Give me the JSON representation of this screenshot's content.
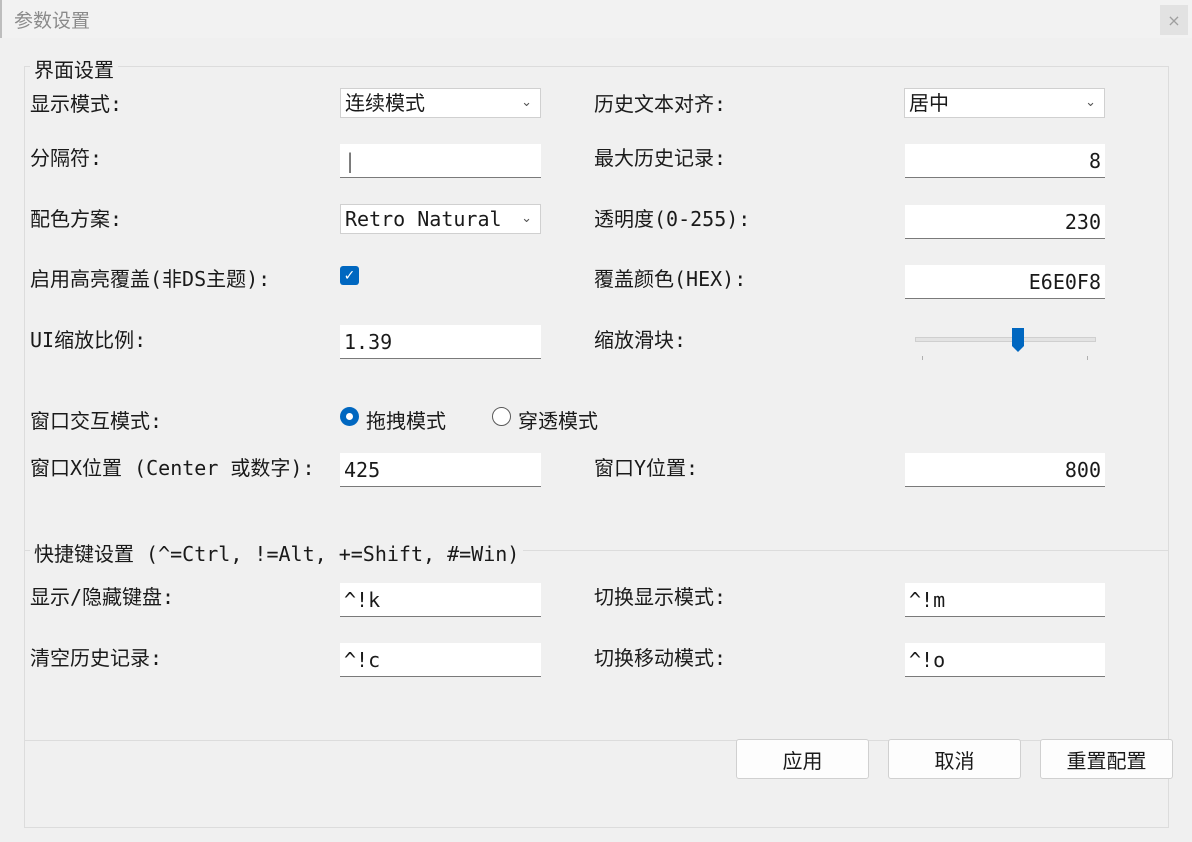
{
  "window": {
    "title": "参数设置",
    "close_glyph": "×"
  },
  "ui_group": {
    "label": "界面设置",
    "display_mode": {
      "label": "显示模式:",
      "value": "连续模式"
    },
    "history_align": {
      "label": "历史文本对齐:",
      "value": "居中"
    },
    "separator": {
      "label": "分隔符:",
      "value": "|"
    },
    "max_history": {
      "label": "最大历史记录:",
      "value": "8"
    },
    "color_scheme": {
      "label": "配色方案:",
      "value": "Retro Natural"
    },
    "opacity": {
      "label": "透明度(0-255):",
      "value": "230"
    },
    "highlight_override": {
      "label": "启用高亮覆盖(非DS主题):",
      "checked": true
    },
    "override_color": {
      "label": "覆盖颜色(HEX):",
      "value": "E6E0F8"
    },
    "ui_scale": {
      "label": "UI缩放比例:",
      "value": "1.39"
    },
    "scale_slider": {
      "label": "缩放滑块:",
      "level": 0.58
    },
    "interaction_mode": {
      "label": "窗口交互模式:",
      "options": [
        "拖拽模式",
        "穿透模式"
      ],
      "selected": "拖拽模式"
    },
    "window_x": {
      "label": "窗口X位置 (Center 或数字):",
      "value": "425"
    },
    "window_y": {
      "label": "窗口Y位置:",
      "value": "800"
    }
  },
  "hotkey_group": {
    "label": "快捷键设置 (^=Ctrl, !=Alt, +=Shift, #=Win)",
    "toggle_keyboard": {
      "label": "显示/隐藏键盘:",
      "value": "^!k"
    },
    "toggle_display_mode": {
      "label": "切换显示模式:",
      "value": "^!m"
    },
    "clear_history": {
      "label": "清空历史记录:",
      "value": "^!c"
    },
    "toggle_move_mode": {
      "label": "切换移动模式:",
      "value": "^!o"
    }
  },
  "buttons": {
    "apply": "应用",
    "cancel": "取消",
    "reset": "重置配置"
  },
  "colors": {
    "accent": "#0067c0",
    "background": "#f0f0f0"
  }
}
